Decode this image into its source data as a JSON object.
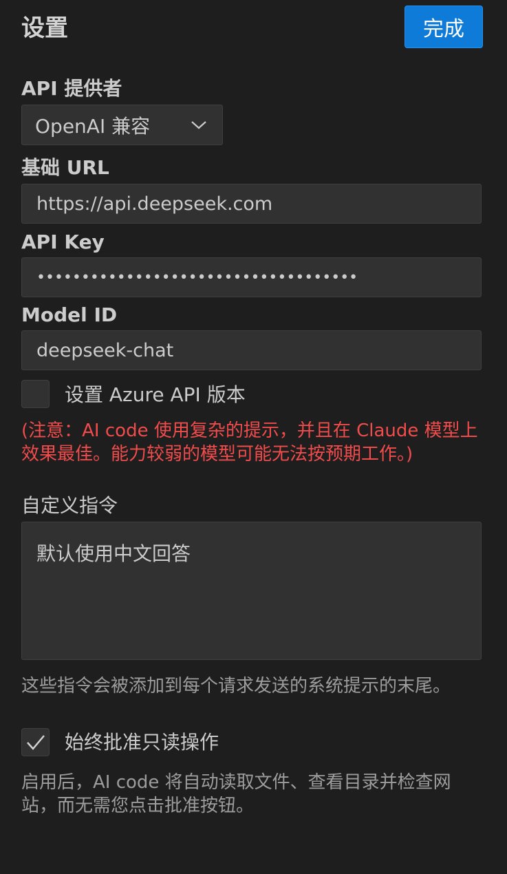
{
  "header": {
    "title": "设置",
    "done_label": "完成"
  },
  "api_provider": {
    "label": "API 提供者",
    "selected": "OpenAI 兼容"
  },
  "base_url": {
    "label": "基础 URL",
    "value": "https://api.deepseek.com"
  },
  "api_key": {
    "label": "API Key",
    "value": "••••••••••••••••••••••••••••••••••••"
  },
  "model_id": {
    "label": "Model ID",
    "value": "deepseek-chat"
  },
  "azure_version": {
    "label": "设置 Azure API 版本",
    "checked": false
  },
  "warning_text": "(注意：AI code 使用复杂的提示，并且在 Claude 模型上效果最佳。能力较弱的模型可能无法按预期工作。)",
  "custom_instructions": {
    "label": "自定义指令",
    "value": "默认使用中文回答",
    "help": "这些指令会被添加到每个请求发送的系统提示的末尾。"
  },
  "always_approve": {
    "label": "始终批准只读操作",
    "checked": true,
    "help": "启用后，AI code 将自动读取文件、查看目录并检查网站，而无需您点击批准按钮。"
  },
  "colors": {
    "background": "#1e1e1e",
    "accent": "#0e7bd8",
    "warning": "#f14c4c"
  },
  "icons": {
    "select_chevron": "chevron-down-icon",
    "checkmark": "checkmark-icon"
  }
}
